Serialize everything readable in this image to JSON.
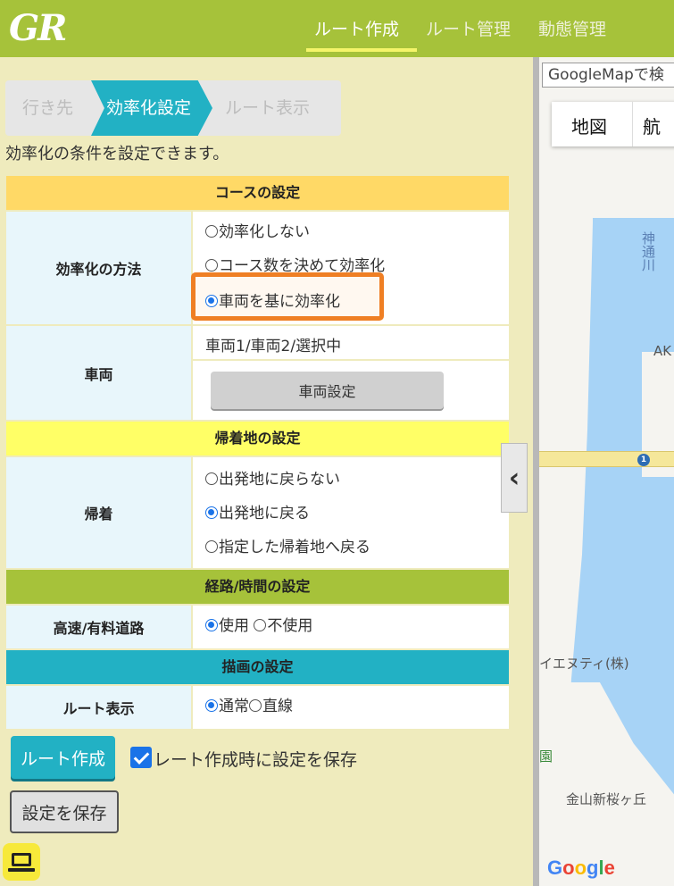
{
  "header": {
    "logo": "GR",
    "nav": [
      {
        "label": "ルート作成",
        "active": true
      },
      {
        "label": "ルート管理",
        "active": false
      },
      {
        "label": "動態管理",
        "active": false
      }
    ]
  },
  "steps": [
    "行き先",
    "効率化設定",
    "ルート表示"
  ],
  "description": "効率化の条件を設定できます。",
  "course": {
    "header": "コースの設定",
    "method_label": "効率化の方法",
    "method_options": [
      "効率化しない",
      "コース数を決めて効率化",
      "車両を基に効率化"
    ],
    "method_selected": 2,
    "vehicle_label": "車両",
    "vehicle_value": "車両1/車両2/選択中",
    "vehicle_button": "車両設定"
  },
  "return": {
    "header": "帰着地の設定",
    "label": "帰着",
    "options": [
      "出発地に戻らない",
      "出発地に戻る",
      "指定した帰着地へ戻る"
    ],
    "selected": 1
  },
  "route_time": {
    "header": "経路/時間の設定",
    "label": "高速/有料道路",
    "options": [
      "使用",
      "不使用"
    ],
    "selected": 0
  },
  "drawing": {
    "header": "描画の設定",
    "label": "ルート表示",
    "options": [
      "通常",
      "直線"
    ],
    "selected": 0
  },
  "actions": {
    "create_button": "ルート作成",
    "save_checkbox_label": "レート作成時に設定を保存",
    "save_checked": true,
    "save_button": "設定を保存"
  },
  "colors": {
    "header_bg": "#a6c23a",
    "accent": "#22b1c4",
    "highlight": "#ef7f24",
    "course_header": "#ffd966",
    "return_header": "#ffff66",
    "route_header": "#a6c23a",
    "draw_header": "#22b1c4"
  },
  "map": {
    "search_placeholder": "GoogleMapで検",
    "type_map": "地図",
    "type_other": "航",
    "labels": [
      "神通川",
      "AK",
      "イエヌティ(株)",
      "園",
      "金山新桜ヶ丘"
    ],
    "road_number": "1",
    "google": "Google"
  }
}
